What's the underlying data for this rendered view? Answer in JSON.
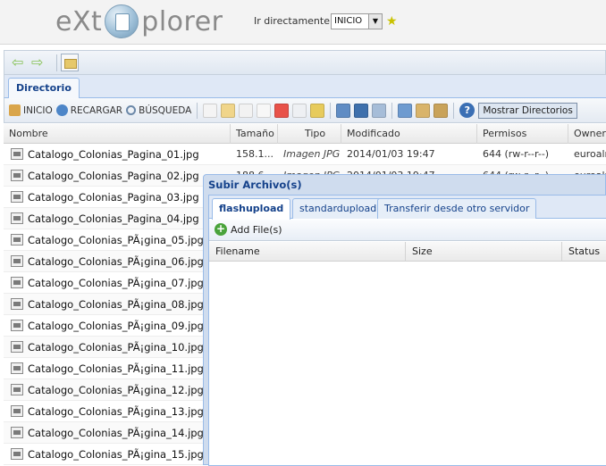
{
  "header": {
    "logo_left": "eXt",
    "logo_right": "plorer",
    "goto_label": "Ir directamente a:",
    "goto_value": "INICIO"
  },
  "tabs": {
    "directorio": "Directorio"
  },
  "toolbar": {
    "inicio": "INICIO",
    "recargar": "RECARGAR",
    "busqueda": "BÚSQUEDA",
    "show_dirs": "Mostrar Directorios"
  },
  "grid": {
    "columns": [
      "Nombre",
      "Tamaño",
      "Tipo",
      "Modificado",
      "Permisos",
      "Owner"
    ],
    "rows": [
      {
        "name": "Catalogo_Colonias_Pagina_01.jpg",
        "size": "158.1...",
        "type": "Imagen JPG",
        "modified": "2014/01/03 19:47",
        "perms": "644 (rw-r--r--)",
        "owner": "euroalm"
      },
      {
        "name": "Catalogo_Colonias_Pagina_02.jpg",
        "size": "188.6...",
        "type": "Imagen JPG",
        "modified": "2014/01/03 19:47",
        "perms": "644 (rw-r--r--)",
        "owner": "euroalm"
      },
      {
        "name": "Catalogo_Colonias_Pagina_03.jpg",
        "size": "",
        "type": "",
        "modified": "",
        "perms": "",
        "owner": ""
      },
      {
        "name": "Catalogo_Colonias_Pagina_04.jpg",
        "size": "",
        "type": "",
        "modified": "",
        "perms": "",
        "owner": ""
      },
      {
        "name": "Catalogo_Colonias_PÃ¡gina_05.jpg",
        "size": "",
        "type": "",
        "modified": "",
        "perms": "",
        "owner": ""
      },
      {
        "name": "Catalogo_Colonias_PÃ¡gina_06.jpg",
        "size": "",
        "type": "",
        "modified": "",
        "perms": "",
        "owner": ""
      },
      {
        "name": "Catalogo_Colonias_PÃ¡gina_07.jpg",
        "size": "",
        "type": "",
        "modified": "",
        "perms": "",
        "owner": ""
      },
      {
        "name": "Catalogo_Colonias_PÃ¡gina_08.jpg",
        "size": "",
        "type": "",
        "modified": "",
        "perms": "",
        "owner": ""
      },
      {
        "name": "Catalogo_Colonias_PÃ¡gina_09.jpg",
        "size": "",
        "type": "",
        "modified": "",
        "perms": "",
        "owner": ""
      },
      {
        "name": "Catalogo_Colonias_PÃ¡gina_10.jpg",
        "size": "",
        "type": "",
        "modified": "",
        "perms": "",
        "owner": ""
      },
      {
        "name": "Catalogo_Colonias_PÃ¡gina_11.jpg",
        "size": "",
        "type": "",
        "modified": "",
        "perms": "",
        "owner": ""
      },
      {
        "name": "Catalogo_Colonias_PÃ¡gina_12.jpg",
        "size": "",
        "type": "",
        "modified": "",
        "perms": "",
        "owner": ""
      },
      {
        "name": "Catalogo_Colonias_PÃ¡gina_13.jpg",
        "size": "",
        "type": "",
        "modified": "",
        "perms": "",
        "owner": ""
      },
      {
        "name": "Catalogo_Colonias_PÃ¡gina_14.jpg",
        "size": "",
        "type": "",
        "modified": "",
        "perms": "",
        "owner": ""
      },
      {
        "name": "Catalogo_Colonias_PÃ¡gina_15.jpg",
        "size": "",
        "type": "",
        "modified": "",
        "perms": "",
        "owner": ""
      }
    ]
  },
  "upload": {
    "title": "Subir Archivo(s)",
    "tabs": [
      "flashupload",
      "standardupload",
      "Transferir desde otro servidor"
    ],
    "add_files": "Add File(s)",
    "columns": [
      "Filename",
      "Size",
      "Status"
    ]
  },
  "colors": {
    "accent": "#15428b",
    "tab_border": "#99bbe8",
    "green": "#86c256"
  },
  "icons": [
    "left-arrow-icon",
    "right-arrow-icon",
    "folder-icon",
    "home-icon",
    "reload-icon",
    "search-icon",
    "help-icon",
    "add-icon",
    "image-file-icon",
    "star-icon"
  ]
}
